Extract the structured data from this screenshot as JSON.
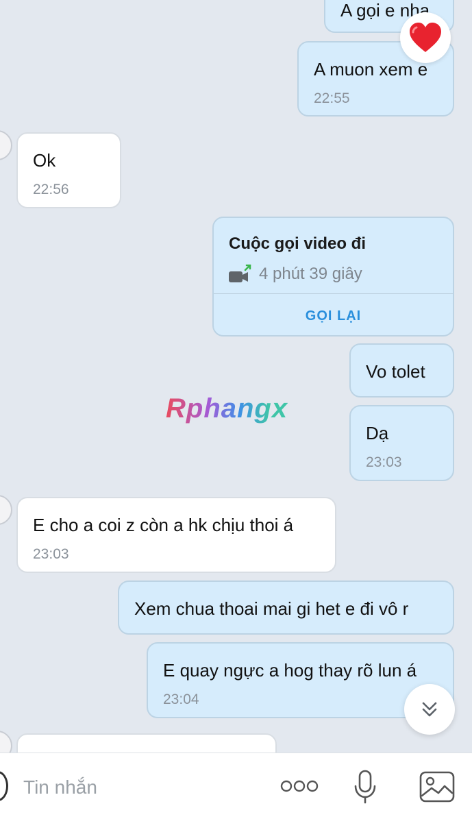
{
  "messages": {
    "m1": {
      "text": "A gọi e nha"
    },
    "m2": {
      "text": "A muon xem e",
      "time": "22:55"
    },
    "m3": {
      "text": "Ok",
      "time": "22:56"
    },
    "call": {
      "title": "Cuộc gọi video đi",
      "duration": "4 phút 39 giây",
      "action": "GỌI LẠI"
    },
    "m5": {
      "text": "Vo tolet"
    },
    "m6": {
      "text": "Dạ",
      "time": "23:03"
    },
    "m7": {
      "text": "E cho a coi z còn a hk chịu thoi á",
      "time": "23:03"
    },
    "m8": {
      "text": "Xem chua thoai mai gi het e đi vô r"
    },
    "m9": {
      "text": "E quay ngực a hog thay rõ lun á",
      "time": "23:04"
    }
  },
  "reaction": {
    "icon": "heart-icon",
    "color": "#e8232f"
  },
  "watermark": "Rphangx",
  "composer": {
    "placeholder": "Tin nhắn",
    "icons": [
      "more-icon",
      "microphone-icon",
      "image-icon"
    ]
  },
  "colors": {
    "outgoing_bubble": "#d6ecfc",
    "incoming_bubble": "#ffffff",
    "background": "#e3e8ef",
    "accent": "#2a8fdc"
  }
}
